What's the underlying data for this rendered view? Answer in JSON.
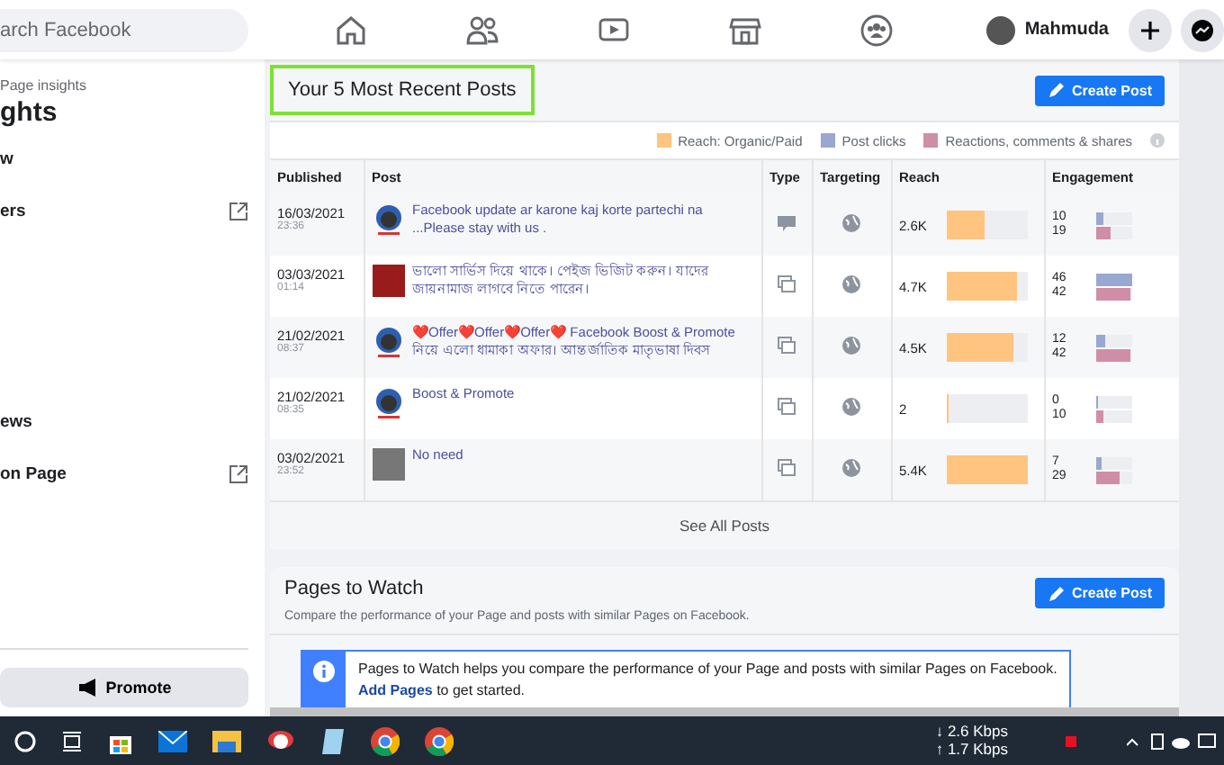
{
  "topbar": {
    "search_placeholder": "arch Facebook",
    "user_name": "Mahmuda"
  },
  "sidebar": {
    "breadcrumb": "Page insights",
    "title": "ghts",
    "items": [
      {
        "label": "w",
        "external": false
      },
      {
        "label": "ers",
        "external": true
      },
      {
        "label": "ews",
        "external": false
      },
      {
        "label": "on Page",
        "external": true
      }
    ],
    "promote_button": "Promote"
  },
  "posts_card": {
    "title": "Your 5 Most Recent Posts",
    "create_button": "Create Post",
    "legend": [
      {
        "label": "Reach: Organic/Paid",
        "color": "#ffc47f"
      },
      {
        "label": "Post clicks",
        "color": "#98a8d0"
      },
      {
        "label": "Reactions, comments & shares",
        "color": "#d08ea6"
      }
    ],
    "columns": [
      "Published",
      "Post",
      "Type",
      "Targeting",
      "Reach",
      "Engagement"
    ],
    "rows": [
      {
        "date": "16/03/2021",
        "time": "23:36",
        "text": "Facebook update ar karone kaj korte partechi na ...Please stay with us .",
        "thumb": {
          "kind": "logo"
        },
        "type": {
          "kind": "status"
        },
        "reach": "2.6K",
        "reach_bar": {
          "level": 0.48
        },
        "clicks": "10",
        "clicks_bar": {
          "level": 0.2
        },
        "reactions": "19",
        "reactions_bar": {
          "level": 0.42
        }
      },
      {
        "date": "03/03/2021",
        "time": "01:14",
        "text": "ভালো সার্ভিস দিয়ে থাকে। পেইজ ভিজিট করুন। যাদের জায়নামাজ লাগবে নিতে পারেন।",
        "thumb": {
          "kind": "photo"
        },
        "type": {
          "kind": "album"
        },
        "reach": "4.7K",
        "reach_bar": {
          "level": 0.87
        },
        "clicks": "46",
        "clicks_bar": {
          "level": 1.0
        },
        "reactions": "42",
        "reactions_bar": {
          "level": 0.95
        }
      },
      {
        "date": "21/02/2021",
        "time": "08:37",
        "text": "❤️Offer❤️Offer❤️Offer❤️ Facebook Boost & Promote নিয়ে এলো ধামাকা অফার। আন্তর্জাতিক মাতৃভাষা দিবস",
        "thumb": {
          "kind": "logo"
        },
        "type": {
          "kind": "album"
        },
        "reach": "4.5K",
        "reach_bar": {
          "level": 0.83
        },
        "clicks": "12",
        "clicks_bar": {
          "level": 0.25
        },
        "reactions": "42",
        "reactions_bar": {
          "level": 0.95
        }
      },
      {
        "date": "21/02/2021",
        "time": "08:35",
        "text": "Boost & Promote",
        "thumb": {
          "kind": "logo"
        },
        "type": {
          "kind": "album"
        },
        "reach": "2",
        "reach_bar": {
          "level": 0.02
        },
        "clicks": "0",
        "clicks_bar": {
          "level": 0.03
        },
        "reactions": "10",
        "reactions_bar": {
          "level": 0.22
        }
      },
      {
        "date": "03/02/2021",
        "time": "23:52",
        "text": "No need",
        "thumb": {
          "kind": "photo"
        },
        "type": {
          "kind": "album"
        },
        "reach": "5.4K",
        "reach_bar": {
          "level": 1.0
        },
        "clicks": "7",
        "clicks_bar": {
          "level": 0.15
        },
        "reactions": "29",
        "reactions_bar": {
          "level": 0.65
        }
      }
    ],
    "see_all": "See All Posts"
  },
  "watch_card": {
    "title": "Pages to Watch",
    "subtitle": "Compare the performance of your Page and posts with similar Pages on Facebook.",
    "create_button": "Create Post",
    "info_text": "Pages to Watch helps you compare the performance of your Page and posts with similar Pages on Facebook.",
    "info_link": "Add Pages",
    "info_after": " to get started."
  },
  "taskbar": {
    "net_down": "↓ 2.6 Kbps",
    "net_up": "↑ 1.7 Kbps"
  }
}
